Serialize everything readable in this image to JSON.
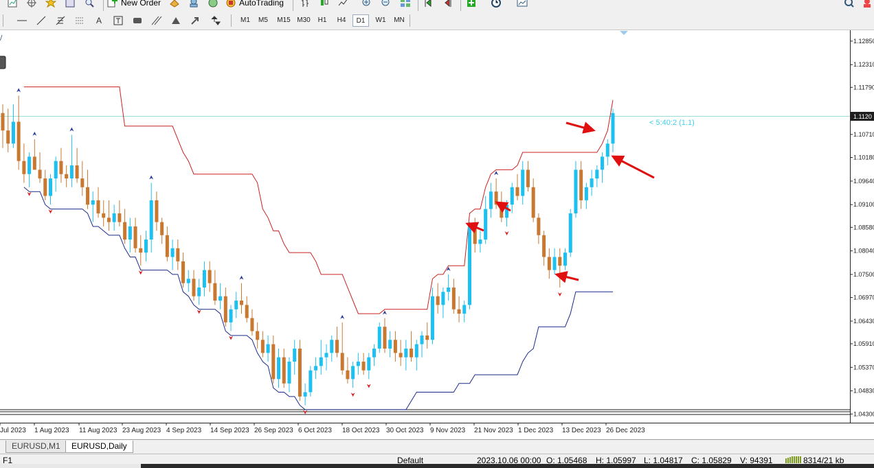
{
  "toolbar": {
    "new_order_label": "New Order",
    "autotrading_label": "AutoTrading",
    "timeframes": [
      "M1",
      "M5",
      "M15",
      "M30",
      "H1",
      "H4",
      "D1",
      "W1",
      "MN"
    ],
    "active_timeframe": "D1"
  },
  "chart": {
    "timer_text": "< 5:40:2 (1.1)",
    "current_price_label": "1.1120",
    "price_labels": [
      "1.12850",
      "1.12310",
      "1.11790",
      "1.1120",
      "1.10710",
      "1.10180",
      "1.09640",
      "1.09100",
      "1.08580",
      "1.08040",
      "1.07500",
      "1.06970",
      "1.06430",
      "1.05910",
      "1.05370",
      "1.04830",
      "1.04300"
    ],
    "date_labels": [
      "Jul 2023",
      "1 Aug 2023",
      "11 Aug 2023",
      "23 Aug 2023",
      "4 Sep 2023",
      "14 Sep 2023",
      "26 Sep 2023",
      "6 Oct 2023",
      "18 Oct 2023",
      "30 Oct 2023",
      "9 Nov 2023",
      "21 Nov 2023",
      "1 Dec 2023",
      "13 Dec 2023",
      "26 Dec 2023"
    ]
  },
  "chart_data": {
    "type": "candlestick",
    "symbol": "EURUSD",
    "timeframe": "Daily",
    "ylim": [
      1.041,
      1.131
    ],
    "up_color": "#1ec0f0",
    "down_color": "#c87830",
    "upper_band_color": "#cc2020",
    "lower_band_color": "#1a2a8a",
    "candles": [
      {
        "o": 1.112,
        "h": 1.114,
        "l": 1.104,
        "c": 1.108
      },
      {
        "o": 1.108,
        "h": 1.113,
        "l": 1.103,
        "c": 1.105
      },
      {
        "o": 1.105,
        "h": 1.114,
        "l": 1.104,
        "c": 1.11
      },
      {
        "o": 1.11,
        "h": 1.116,
        "l": 1.099,
        "c": 1.101
      },
      {
        "o": 1.101,
        "h": 1.105,
        "l": 1.096,
        "c": 1.098
      },
      {
        "o": 1.098,
        "h": 1.103,
        "l": 1.095,
        "c": 1.102
      },
      {
        "o": 1.102,
        "h": 1.106,
        "l": 1.099,
        "c": 1.099
      },
      {
        "o": 1.099,
        "h": 1.103,
        "l": 1.096,
        "c": 1.097
      },
      {
        "o": 1.097,
        "h": 1.099,
        "l": 1.092,
        "c": 1.093
      },
      {
        "o": 1.093,
        "h": 1.098,
        "l": 1.091,
        "c": 1.097
      },
      {
        "o": 1.097,
        "h": 1.102,
        "l": 1.094,
        "c": 1.101
      },
      {
        "o": 1.101,
        "h": 1.104,
        "l": 1.096,
        "c": 1.098
      },
      {
        "o": 1.098,
        "h": 1.1,
        "l": 1.095,
        "c": 1.097
      },
      {
        "o": 1.097,
        "h": 1.107,
        "l": 1.095,
        "c": 1.1
      },
      {
        "o": 1.1,
        "h": 1.104,
        "l": 1.096,
        "c": 1.097
      },
      {
        "o": 1.097,
        "h": 1.101,
        "l": 1.093,
        "c": 1.095
      },
      {
        "o": 1.095,
        "h": 1.099,
        "l": 1.09,
        "c": 1.091
      },
      {
        "o": 1.091,
        "h": 1.094,
        "l": 1.087,
        "c": 1.092
      },
      {
        "o": 1.092,
        "h": 1.095,
        "l": 1.088,
        "c": 1.089
      },
      {
        "o": 1.089,
        "h": 1.092,
        "l": 1.086,
        "c": 1.088
      },
      {
        "o": 1.088,
        "h": 1.092,
        "l": 1.085,
        "c": 1.087
      },
      {
        "o": 1.087,
        "h": 1.091,
        "l": 1.085,
        "c": 1.089
      },
      {
        "o": 1.089,
        "h": 1.092,
        "l": 1.086,
        "c": 1.087
      },
      {
        "o": 1.087,
        "h": 1.09,
        "l": 1.082,
        "c": 1.083
      },
      {
        "o": 1.083,
        "h": 1.088,
        "l": 1.08,
        "c": 1.086
      },
      {
        "o": 1.086,
        "h": 1.088,
        "l": 1.08,
        "c": 1.081
      },
      {
        "o": 1.081,
        "h": 1.084,
        "l": 1.077,
        "c": 1.08
      },
      {
        "o": 1.08,
        "h": 1.085,
        "l": 1.078,
        "c": 1.083
      },
      {
        "o": 1.083,
        "h": 1.096,
        "l": 1.08,
        "c": 1.092
      },
      {
        "o": 1.092,
        "h": 1.094,
        "l": 1.085,
        "c": 1.087
      },
      {
        "o": 1.087,
        "h": 1.088,
        "l": 1.082,
        "c": 1.084
      },
      {
        "o": 1.084,
        "h": 1.086,
        "l": 1.078,
        "c": 1.079
      },
      {
        "o": 1.079,
        "h": 1.083,
        "l": 1.076,
        "c": 1.081
      },
      {
        "o": 1.081,
        "h": 1.083,
        "l": 1.076,
        "c": 1.078
      },
      {
        "o": 1.078,
        "h": 1.08,
        "l": 1.072,
        "c": 1.073
      },
      {
        "o": 1.073,
        "h": 1.076,
        "l": 1.071,
        "c": 1.074
      },
      {
        "o": 1.074,
        "h": 1.076,
        "l": 1.069,
        "c": 1.07
      },
      {
        "o": 1.07,
        "h": 1.074,
        "l": 1.068,
        "c": 1.072
      },
      {
        "o": 1.072,
        "h": 1.078,
        "l": 1.07,
        "c": 1.076
      },
      {
        "o": 1.076,
        "h": 1.078,
        "l": 1.071,
        "c": 1.073
      },
      {
        "o": 1.073,
        "h": 1.076,
        "l": 1.068,
        "c": 1.069
      },
      {
        "o": 1.069,
        "h": 1.073,
        "l": 1.067,
        "c": 1.07
      },
      {
        "o": 1.07,
        "h": 1.072,
        "l": 1.063,
        "c": 1.064
      },
      {
        "o": 1.064,
        "h": 1.068,
        "l": 1.062,
        "c": 1.067
      },
      {
        "o": 1.067,
        "h": 1.071,
        "l": 1.065,
        "c": 1.069
      },
      {
        "o": 1.069,
        "h": 1.073,
        "l": 1.066,
        "c": 1.068
      },
      {
        "o": 1.068,
        "h": 1.07,
        "l": 1.064,
        "c": 1.065
      },
      {
        "o": 1.065,
        "h": 1.067,
        "l": 1.061,
        "c": 1.062
      },
      {
        "o": 1.062,
        "h": 1.064,
        "l": 1.058,
        "c": 1.06
      },
      {
        "o": 1.06,
        "h": 1.062,
        "l": 1.056,
        "c": 1.057
      },
      {
        "o": 1.057,
        "h": 1.061,
        "l": 1.055,
        "c": 1.059
      },
      {
        "o": 1.059,
        "h": 1.061,
        "l": 1.05,
        "c": 1.051
      },
      {
        "o": 1.051,
        "h": 1.058,
        "l": 1.049,
        "c": 1.056
      },
      {
        "o": 1.056,
        "h": 1.058,
        "l": 1.049,
        "c": 1.05
      },
      {
        "o": 1.05,
        "h": 1.056,
        "l": 1.048,
        "c": 1.055
      },
      {
        "o": 1.055,
        "h": 1.06,
        "l": 1.052,
        "c": 1.058
      },
      {
        "o": 1.058,
        "h": 1.06,
        "l": 1.046,
        "c": 1.047
      },
      {
        "o": 1.047,
        "h": 1.05,
        "l": 1.045,
        "c": 1.048
      },
      {
        "o": 1.048,
        "h": 1.054,
        "l": 1.047,
        "c": 1.053
      },
      {
        "o": 1.053,
        "h": 1.056,
        "l": 1.051,
        "c": 1.054
      },
      {
        "o": 1.054,
        "h": 1.06,
        "l": 1.052,
        "c": 1.056
      },
      {
        "o": 1.056,
        "h": 1.059,
        "l": 1.053,
        "c": 1.057
      },
      {
        "o": 1.057,
        "h": 1.061,
        "l": 1.055,
        "c": 1.06
      },
      {
        "o": 1.06,
        "h": 1.063,
        "l": 1.056,
        "c": 1.057
      },
      {
        "o": 1.057,
        "h": 1.064,
        "l": 1.052,
        "c": 1.053
      },
      {
        "o": 1.053,
        "h": 1.056,
        "l": 1.05,
        "c": 1.051
      },
      {
        "o": 1.051,
        "h": 1.055,
        "l": 1.049,
        "c": 1.054
      },
      {
        "o": 1.054,
        "h": 1.057,
        "l": 1.052,
        "c": 1.055
      },
      {
        "o": 1.055,
        "h": 1.057,
        "l": 1.052,
        "c": 1.053
      },
      {
        "o": 1.053,
        "h": 1.057,
        "l": 1.051,
        "c": 1.056
      },
      {
        "o": 1.056,
        "h": 1.059,
        "l": 1.054,
        "c": 1.058
      },
      {
        "o": 1.058,
        "h": 1.064,
        "l": 1.057,
        "c": 1.063
      },
      {
        "o": 1.063,
        "h": 1.065,
        "l": 1.057,
        "c": 1.058
      },
      {
        "o": 1.058,
        "h": 1.062,
        "l": 1.056,
        "c": 1.06
      },
      {
        "o": 1.06,
        "h": 1.062,
        "l": 1.055,
        "c": 1.057
      },
      {
        "o": 1.057,
        "h": 1.06,
        "l": 1.054,
        "c": 1.056
      },
      {
        "o": 1.056,
        "h": 1.06,
        "l": 1.053,
        "c": 1.058
      },
      {
        "o": 1.058,
        "h": 1.062,
        "l": 1.055,
        "c": 1.056
      },
      {
        "o": 1.056,
        "h": 1.06,
        "l": 1.053,
        "c": 1.059
      },
      {
        "o": 1.059,
        "h": 1.062,
        "l": 1.056,
        "c": 1.061
      },
      {
        "o": 1.061,
        "h": 1.064,
        "l": 1.058,
        "c": 1.06
      },
      {
        "o": 1.06,
        "h": 1.072,
        "l": 1.059,
        "c": 1.07
      },
      {
        "o": 1.07,
        "h": 1.073,
        "l": 1.066,
        "c": 1.068
      },
      {
        "o": 1.068,
        "h": 1.072,
        "l": 1.065,
        "c": 1.071
      },
      {
        "o": 1.071,
        "h": 1.075,
        "l": 1.069,
        "c": 1.072
      },
      {
        "o": 1.072,
        "h": 1.074,
        "l": 1.066,
        "c": 1.067
      },
      {
        "o": 1.067,
        "h": 1.07,
        "l": 1.064,
        "c": 1.066
      },
      {
        "o": 1.066,
        "h": 1.069,
        "l": 1.064,
        "c": 1.068
      },
      {
        "o": 1.068,
        "h": 1.087,
        "l": 1.067,
        "c": 1.086
      },
      {
        "o": 1.086,
        "h": 1.088,
        "l": 1.08,
        "c": 1.082
      },
      {
        "o": 1.082,
        "h": 1.085,
        "l": 1.08,
        "c": 1.083
      },
      {
        "o": 1.083,
        "h": 1.093,
        "l": 1.082,
        "c": 1.09
      },
      {
        "o": 1.09,
        "h": 1.096,
        "l": 1.088,
        "c": 1.094
      },
      {
        "o": 1.094,
        "h": 1.097,
        "l": 1.09,
        "c": 1.091
      },
      {
        "o": 1.091,
        "h": 1.094,
        "l": 1.087,
        "c": 1.088
      },
      {
        "o": 1.088,
        "h": 1.092,
        "l": 1.086,
        "c": 1.091
      },
      {
        "o": 1.091,
        "h": 1.096,
        "l": 1.089,
        "c": 1.095
      },
      {
        "o": 1.095,
        "h": 1.098,
        "l": 1.092,
        "c": 1.093
      },
      {
        "o": 1.093,
        "h": 1.101,
        "l": 1.091,
        "c": 1.099
      },
      {
        "o": 1.099,
        "h": 1.101,
        "l": 1.094,
        "c": 1.095
      },
      {
        "o": 1.095,
        "h": 1.097,
        "l": 1.087,
        "c": 1.088
      },
      {
        "o": 1.088,
        "h": 1.089,
        "l": 1.082,
        "c": 1.084
      },
      {
        "o": 1.084,
        "h": 1.085,
        "l": 1.077,
        "c": 1.079
      },
      {
        "o": 1.079,
        "h": 1.081,
        "l": 1.074,
        "c": 1.076
      },
      {
        "o": 1.076,
        "h": 1.081,
        "l": 1.075,
        "c": 1.079
      },
      {
        "o": 1.079,
        "h": 1.081,
        "l": 1.072,
        "c": 1.077
      },
      {
        "o": 1.077,
        "h": 1.081,
        "l": 1.076,
        "c": 1.08
      },
      {
        "o": 1.08,
        "h": 1.09,
        "l": 1.079,
        "c": 1.089
      },
      {
        "o": 1.089,
        "h": 1.101,
        "l": 1.088,
        "c": 1.099
      },
      {
        "o": 1.099,
        "h": 1.101,
        "l": 1.09,
        "c": 1.092
      },
      {
        "o": 1.092,
        "h": 1.096,
        "l": 1.09,
        "c": 1.095
      },
      {
        "o": 1.095,
        "h": 1.099,
        "l": 1.093,
        "c": 1.097
      },
      {
        "o": 1.097,
        "h": 1.1,
        "l": 1.095,
        "c": 1.099
      },
      {
        "o": 1.099,
        "h": 1.103,
        "l": 1.096,
        "c": 1.102
      },
      {
        "o": 1.102,
        "h": 1.106,
        "l": 1.1,
        "c": 1.105
      },
      {
        "o": 1.105,
        "h": 1.113,
        "l": 1.103,
        "c": 1.112
      }
    ]
  },
  "tabs": [
    "EURUSD,M1",
    "EURUSD,Daily"
  ],
  "active_tab": "EURUSD,Daily",
  "status": {
    "help": "F1",
    "profile": "Default",
    "datetime": "2023.10.06 00:00",
    "open": "O: 1.05468",
    "high": "H: 1.05997",
    "low": "L: 1.04817",
    "close": "C: 1.05829",
    "volume": "V: 94391",
    "traffic": "8314/21 kb"
  }
}
